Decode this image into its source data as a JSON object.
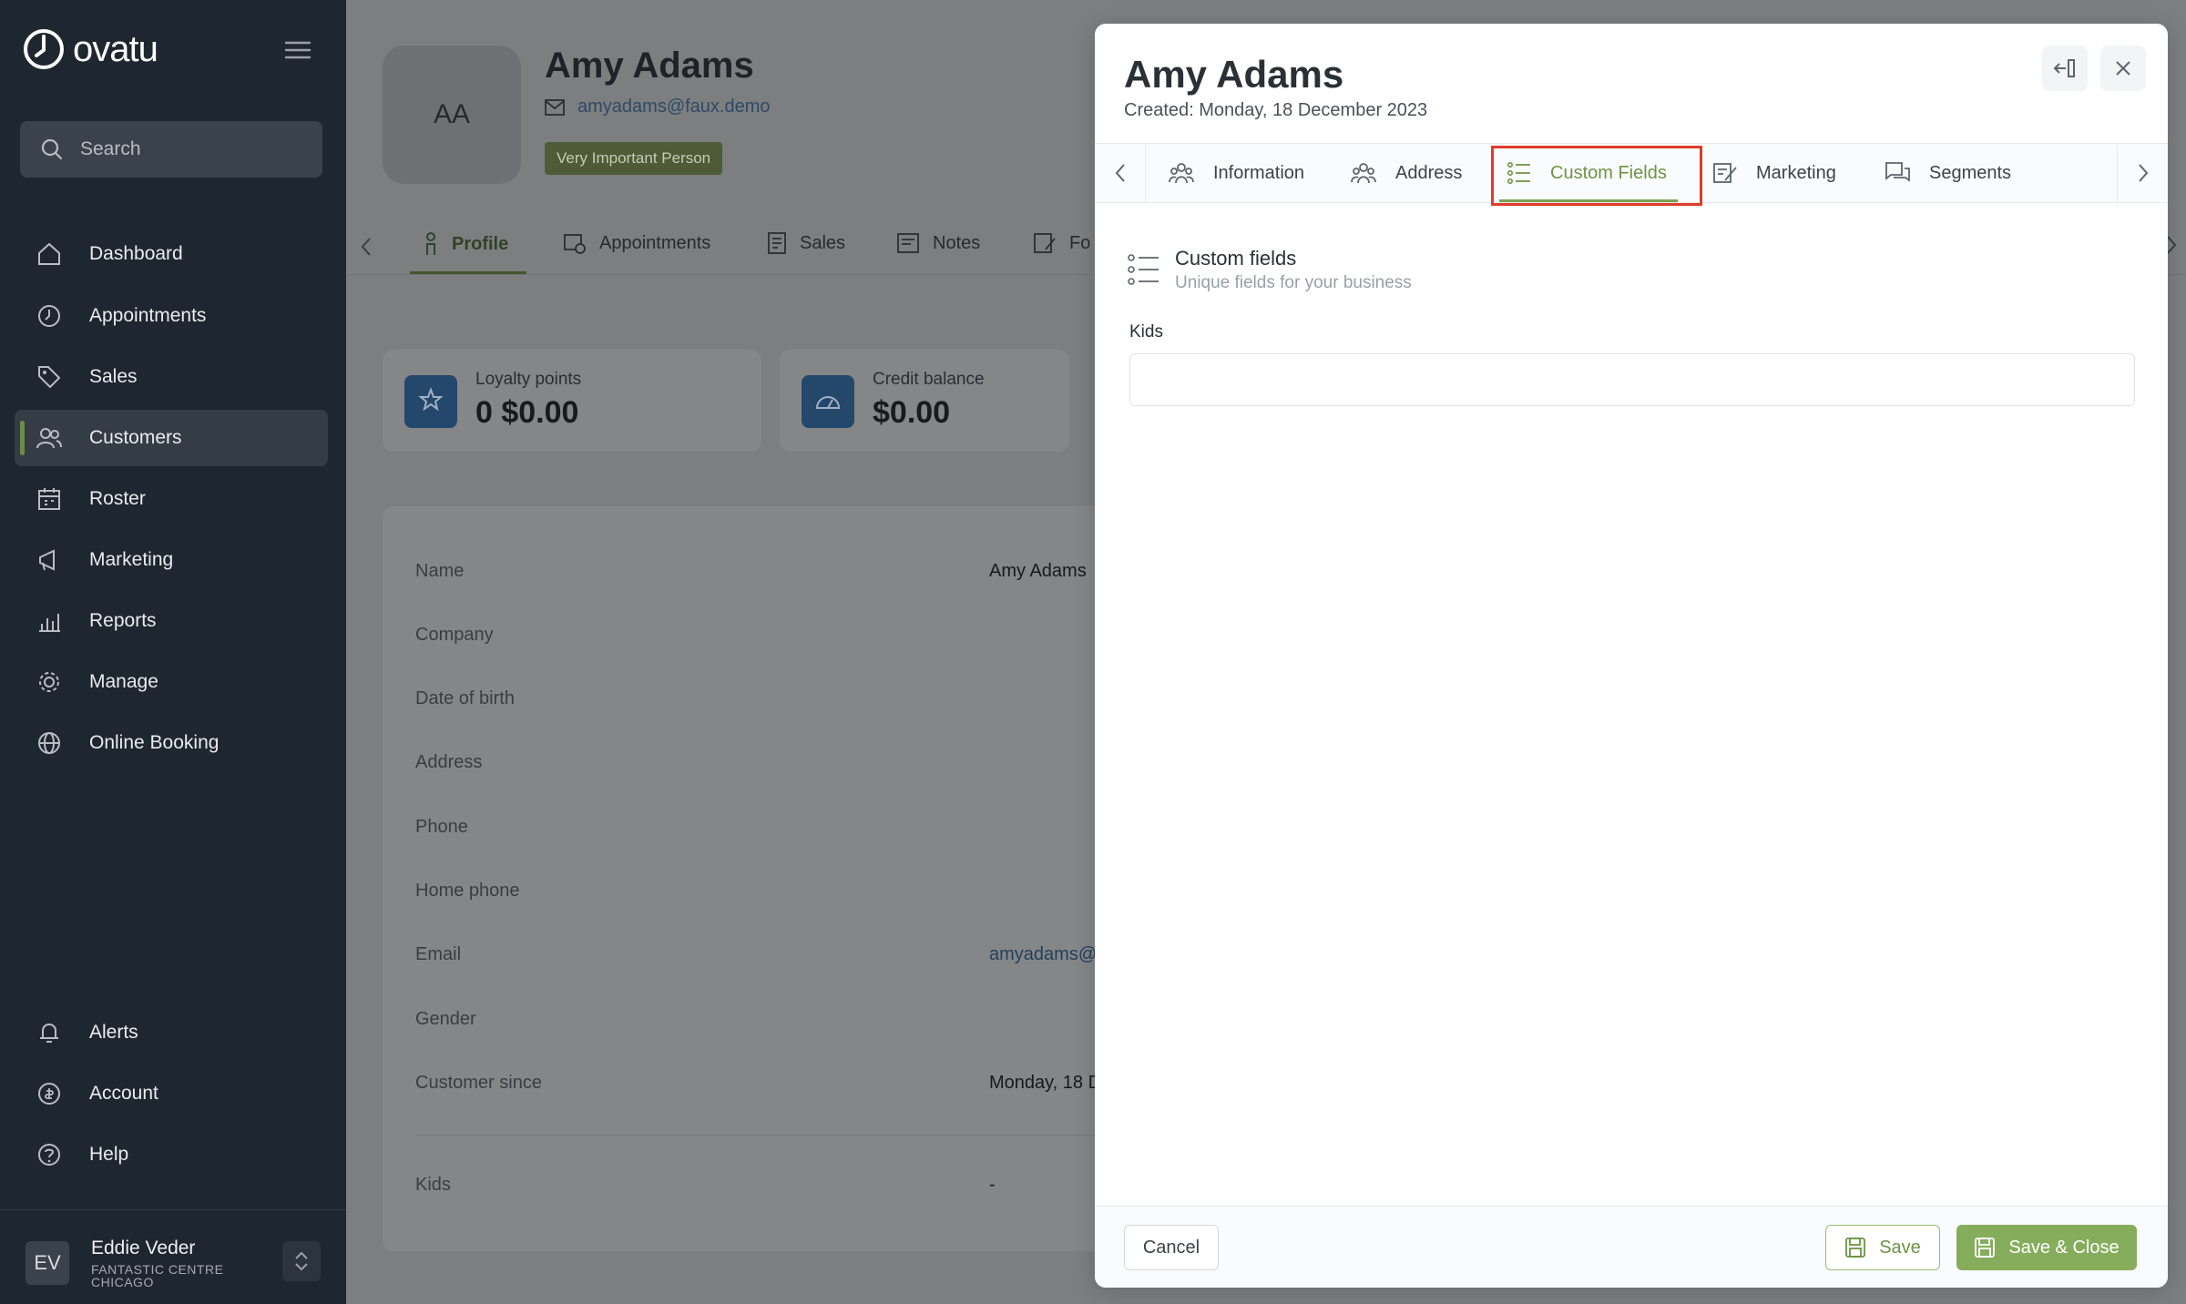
{
  "app": {
    "logo_text": "ovatu"
  },
  "sidebar": {
    "search_placeholder": "Search",
    "items": [
      {
        "label": "Dashboard",
        "icon": "home-icon"
      },
      {
        "label": "Appointments",
        "icon": "clock-icon"
      },
      {
        "label": "Sales",
        "icon": "tag-icon"
      },
      {
        "label": "Customers",
        "icon": "users-icon",
        "active": true
      },
      {
        "label": "Roster",
        "icon": "calendar-icon"
      },
      {
        "label": "Marketing",
        "icon": "megaphone-icon"
      },
      {
        "label": "Reports",
        "icon": "chart-icon"
      },
      {
        "label": "Manage",
        "icon": "gear-icon"
      },
      {
        "label": "Online Booking",
        "icon": "globe-icon"
      }
    ],
    "bottom_items": [
      {
        "label": "Alerts",
        "icon": "bell-icon"
      },
      {
        "label": "Account",
        "icon": "account-icon"
      },
      {
        "label": "Help",
        "icon": "help-icon"
      }
    ],
    "user": {
      "initials": "EV",
      "name": "Eddie Veder",
      "location": "FANTASTIC CENTRE CHICAGO"
    }
  },
  "profile": {
    "initials": "AA",
    "name": "Amy Adams",
    "email": "amyadams@faux.demo",
    "badge": "Very Important Person",
    "tabs": [
      "Profile",
      "Appointments",
      "Sales",
      "Notes",
      "Fo"
    ],
    "loyalty": {
      "label": "Loyalty points",
      "value": "0 $0.00"
    },
    "credit": {
      "label": "Credit balance",
      "value": "$0.00"
    },
    "details": [
      {
        "label": "Name",
        "value": "Amy Adams"
      },
      {
        "label": "Company",
        "value": ""
      },
      {
        "label": "Date of birth",
        "value": ""
      },
      {
        "label": "Address",
        "value": ""
      },
      {
        "label": "Phone",
        "value": ""
      },
      {
        "label": "Home phone",
        "value": ""
      },
      {
        "label": "Email",
        "value": "amyadams@f"
      },
      {
        "label": "Gender",
        "value": ""
      },
      {
        "label": "Customer since",
        "value": "Monday, 18 D"
      },
      {
        "label": "Kids",
        "value": "-"
      }
    ]
  },
  "drawer": {
    "title": "Amy Adams",
    "created": "Created: Monday, 18 December 2023",
    "tabs": [
      {
        "label": "Information",
        "icon": "users-icon"
      },
      {
        "label": "Address",
        "icon": "users-icon"
      },
      {
        "label": "Custom Fields",
        "icon": "list-icon",
        "active": true
      },
      {
        "label": "Marketing",
        "icon": "megaphone-icon"
      },
      {
        "label": "Segments",
        "icon": "chat-icon"
      }
    ],
    "section_title": "Custom fields",
    "section_subtitle": "Unique fields for your business",
    "kids_label": "Kids",
    "kids_value": "",
    "cancel_label": "Cancel",
    "save_label": "Save",
    "save_close_label": "Save & Close"
  },
  "colors": {
    "accent": "#86ad5c",
    "sidebar_bg": "#1e2630",
    "highlight": "#e03c2a"
  }
}
